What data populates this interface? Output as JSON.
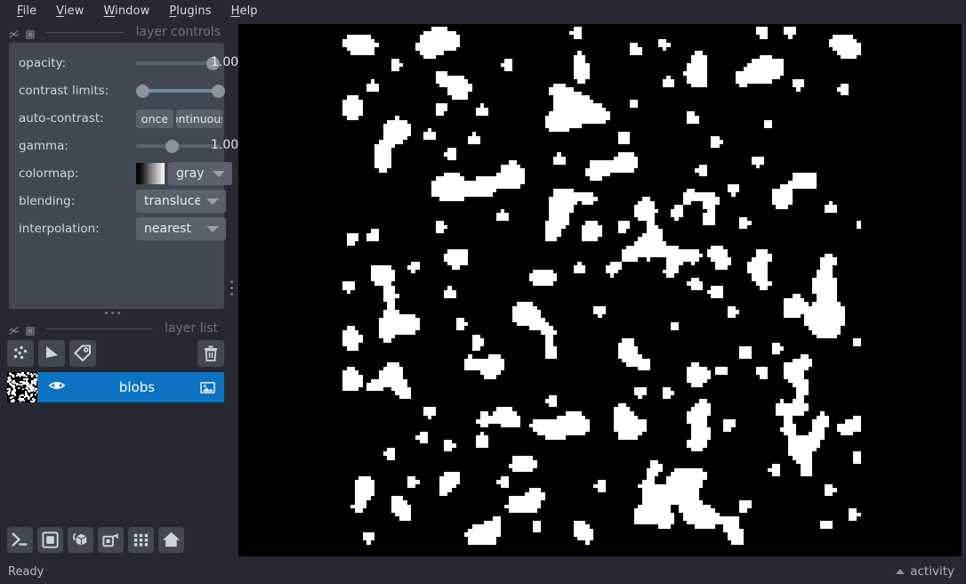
{
  "menu": {
    "items": [
      {
        "label": "File",
        "mnemonic": "F"
      },
      {
        "label": "View",
        "mnemonic": "V"
      },
      {
        "label": "Window",
        "mnemonic": "W"
      },
      {
        "label": "Plugins",
        "mnemonic": "P"
      },
      {
        "label": "Help",
        "mnemonic": "H"
      }
    ]
  },
  "docks": {
    "layer_controls_title": "layer controls",
    "layer_list_title": "layer list",
    "float_icon": "float-icon",
    "close_icon": "close-icon"
  },
  "layer_controls": {
    "rows": [
      {
        "label": "opacity:",
        "value": "1.00"
      },
      {
        "label": "contrast limits:",
        "value": ""
      },
      {
        "label": "auto-contrast:",
        "value": ""
      },
      {
        "label": "gamma:",
        "value": "1.00"
      },
      {
        "label": "colormap:",
        "value": "gray"
      },
      {
        "label": "blending:",
        "value": "translucent"
      },
      {
        "label": "interpolation:",
        "value": "nearest"
      }
    ],
    "opacity": {
      "label": "opacity:",
      "value": "1.00",
      "fraction": 1.0
    },
    "contrast_limits": {
      "label": "contrast limits:",
      "low_fraction": 0.0,
      "high_fraction": 1.0
    },
    "auto_contrast": {
      "label": "auto-contrast:",
      "once_label": "once",
      "continuous_label": "continuous"
    },
    "gamma": {
      "label": "gamma:",
      "value": "1.00",
      "fraction": 0.45
    },
    "colormap": {
      "label": "colormap:",
      "value": "gray",
      "swatch": "gray-gradient-swatch"
    },
    "blending": {
      "label": "blending:",
      "value": "translucent"
    },
    "interpolation": {
      "label": "interpolation:",
      "value": "nearest"
    }
  },
  "layer_list": {
    "buttons": [
      {
        "name": "new-points-layer",
        "icon": "points-icon"
      },
      {
        "name": "new-shapes-layer",
        "icon": "shapes-icon"
      },
      {
        "name": "new-labels-layer",
        "icon": "labels-icon"
      },
      {
        "name": "delete-layer",
        "icon": "trash-icon"
      }
    ],
    "layers": [
      {
        "name": "blobs",
        "visible": true,
        "selected": true,
        "type_icon": "image-layer-icon",
        "visibility_icon": "eye-icon",
        "thumbnail": "binary-blobs-thumbnail"
      }
    ]
  },
  "viewer_buttons": [
    {
      "name": "console-button",
      "icon": "console-icon"
    },
    {
      "name": "ndisplay-button",
      "icon": "square-2d-icon"
    },
    {
      "name": "roll-dims-button",
      "icon": "cube-roll-icon"
    },
    {
      "name": "transpose-dims-button",
      "icon": "transpose-icon"
    },
    {
      "name": "grid-view-button",
      "icon": "grid-icon"
    },
    {
      "name": "home-button",
      "icon": "home-icon"
    }
  ],
  "statusbar": {
    "status": "Ready",
    "activity_label": "activity",
    "activity_icon": "caret-up-icon"
  },
  "canvas": {
    "layer": "blobs",
    "background": "#000000",
    "foreground": "#ffffff",
    "rendering": "nearest"
  },
  "colors": {
    "window_background": "#262930",
    "panel_background": "#414851",
    "control_background": "#5a616d",
    "accent_selected": "#0b72c4",
    "text_primary": "#d6d9de",
    "text_muted": "#6e737d",
    "canvas_background": "#000000"
  }
}
